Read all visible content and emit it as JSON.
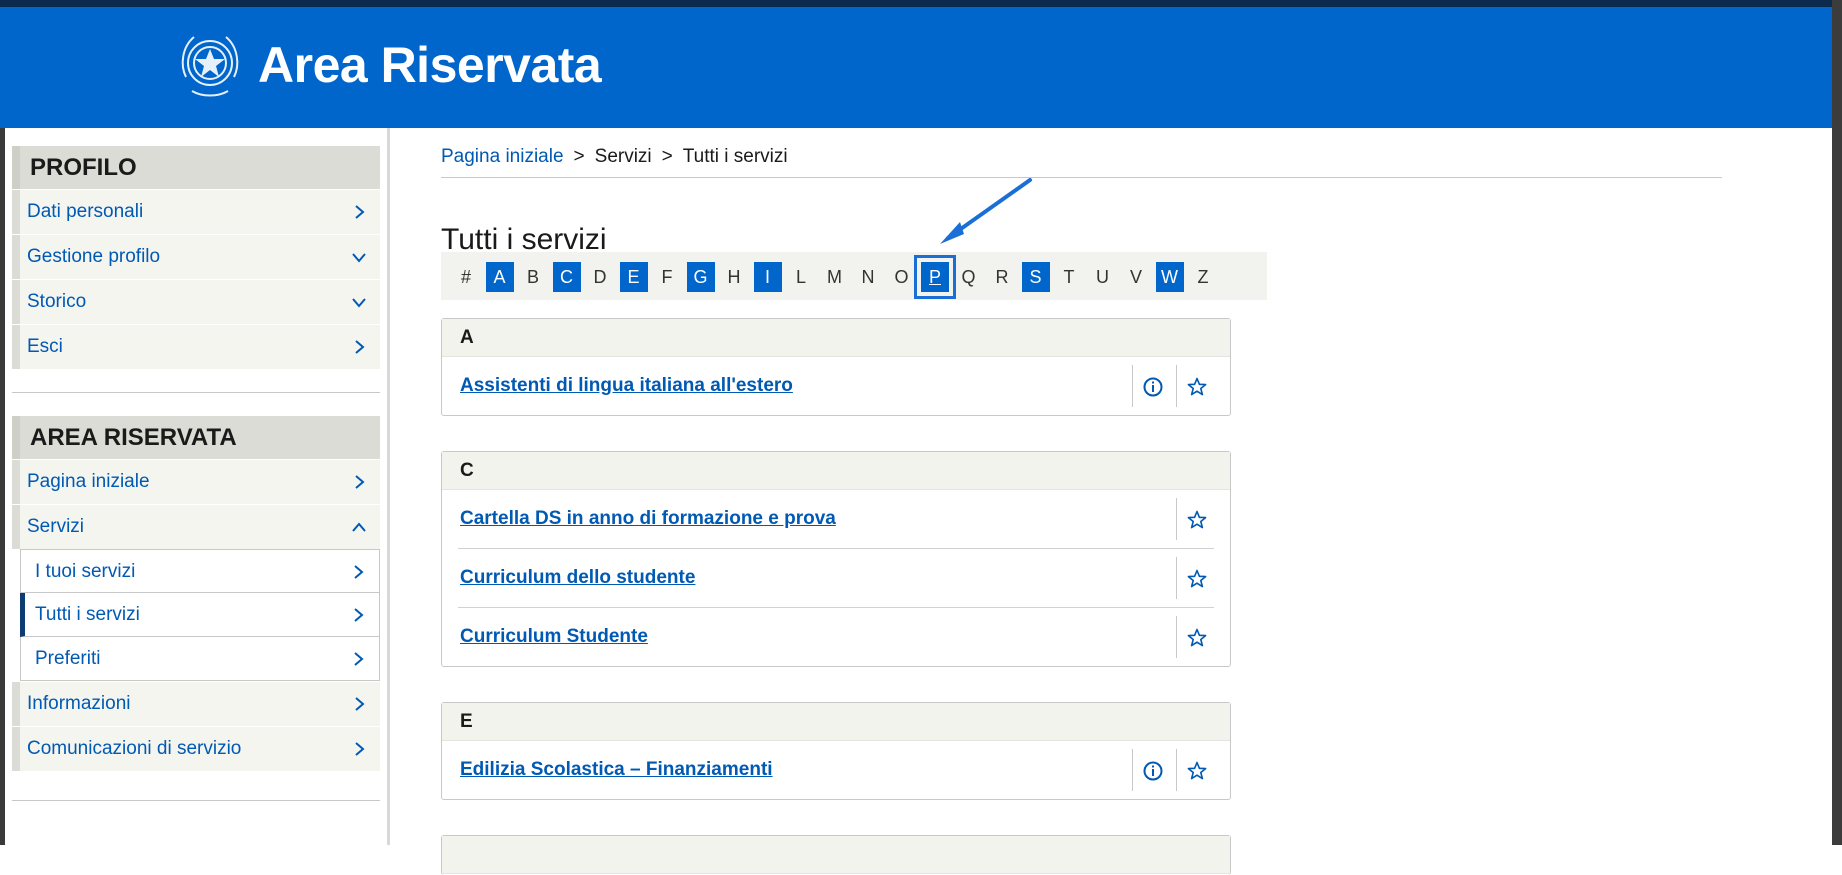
{
  "header": {
    "title": "Area Riservata"
  },
  "sidebar": {
    "profilo": {
      "heading": "PROFILO",
      "items": [
        {
          "label": "Dati personali",
          "chevron": "right"
        },
        {
          "label": "Gestione profilo",
          "chevron": "down"
        },
        {
          "label": "Storico",
          "chevron": "down"
        },
        {
          "label": "Esci",
          "chevron": "right"
        }
      ]
    },
    "area": {
      "heading": "AREA RISERVATA",
      "items": [
        {
          "label": "Pagina iniziale",
          "chevron": "right"
        },
        {
          "label": "Servizi",
          "chevron": "up"
        }
      ],
      "sub_items": [
        {
          "label": "I tuoi servizi"
        },
        {
          "label": "Tutti i servizi",
          "active": true
        },
        {
          "label": "Preferiti"
        }
      ],
      "items_after": [
        {
          "label": "Informazioni",
          "chevron": "right"
        },
        {
          "label": "Comunicazioni di servizio",
          "chevron": "right"
        }
      ]
    }
  },
  "breadcrumb": {
    "home": "Pagina iniziale",
    "servizi": "Servizi",
    "current": "Tutti i servizi",
    "separator": ">"
  },
  "page_title": "Tutti i servizi",
  "alphabet": [
    {
      "l": "#",
      "on": false
    },
    {
      "l": "A",
      "on": true
    },
    {
      "l": "B",
      "on": false
    },
    {
      "l": "C",
      "on": true
    },
    {
      "l": "D",
      "on": false
    },
    {
      "l": "E",
      "on": true
    },
    {
      "l": "F",
      "on": false
    },
    {
      "l": "G",
      "on": true
    },
    {
      "l": "H",
      "on": false
    },
    {
      "l": "I",
      "on": true
    },
    {
      "l": "L",
      "on": false
    },
    {
      "l": "M",
      "on": false
    },
    {
      "l": "N",
      "on": false
    },
    {
      "l": "O",
      "on": false
    },
    {
      "l": "P",
      "on": true,
      "selected": true
    },
    {
      "l": "Q",
      "on": false
    },
    {
      "l": "R",
      "on": false
    },
    {
      "l": "S",
      "on": true
    },
    {
      "l": "T",
      "on": false
    },
    {
      "l": "U",
      "on": false
    },
    {
      "l": "V",
      "on": false
    },
    {
      "l": "W",
      "on": true
    },
    {
      "l": "Z",
      "on": false
    }
  ],
  "groups": [
    {
      "letter": "A",
      "rows": [
        {
          "label": "Assistenti di lingua italiana all'estero",
          "info": true
        }
      ]
    },
    {
      "letter": "C",
      "rows": [
        {
          "label": "Cartella DS in anno di formazione e prova",
          "info": false
        },
        {
          "label": "Curriculum dello studente",
          "info": false
        },
        {
          "label": "Curriculum Studente",
          "info": false
        }
      ]
    },
    {
      "letter": "E",
      "rows": [
        {
          "label": "Edilizia Scolastica – Finanziamenti",
          "info": true
        }
      ]
    }
  ],
  "colors": {
    "brand": "#0066cc",
    "link": "#0059b3",
    "nav_dark": "#0b2a4e"
  },
  "icons": {
    "info": "info-icon",
    "favorite": "star-outline-icon",
    "chevron": "chevron-icon"
  }
}
